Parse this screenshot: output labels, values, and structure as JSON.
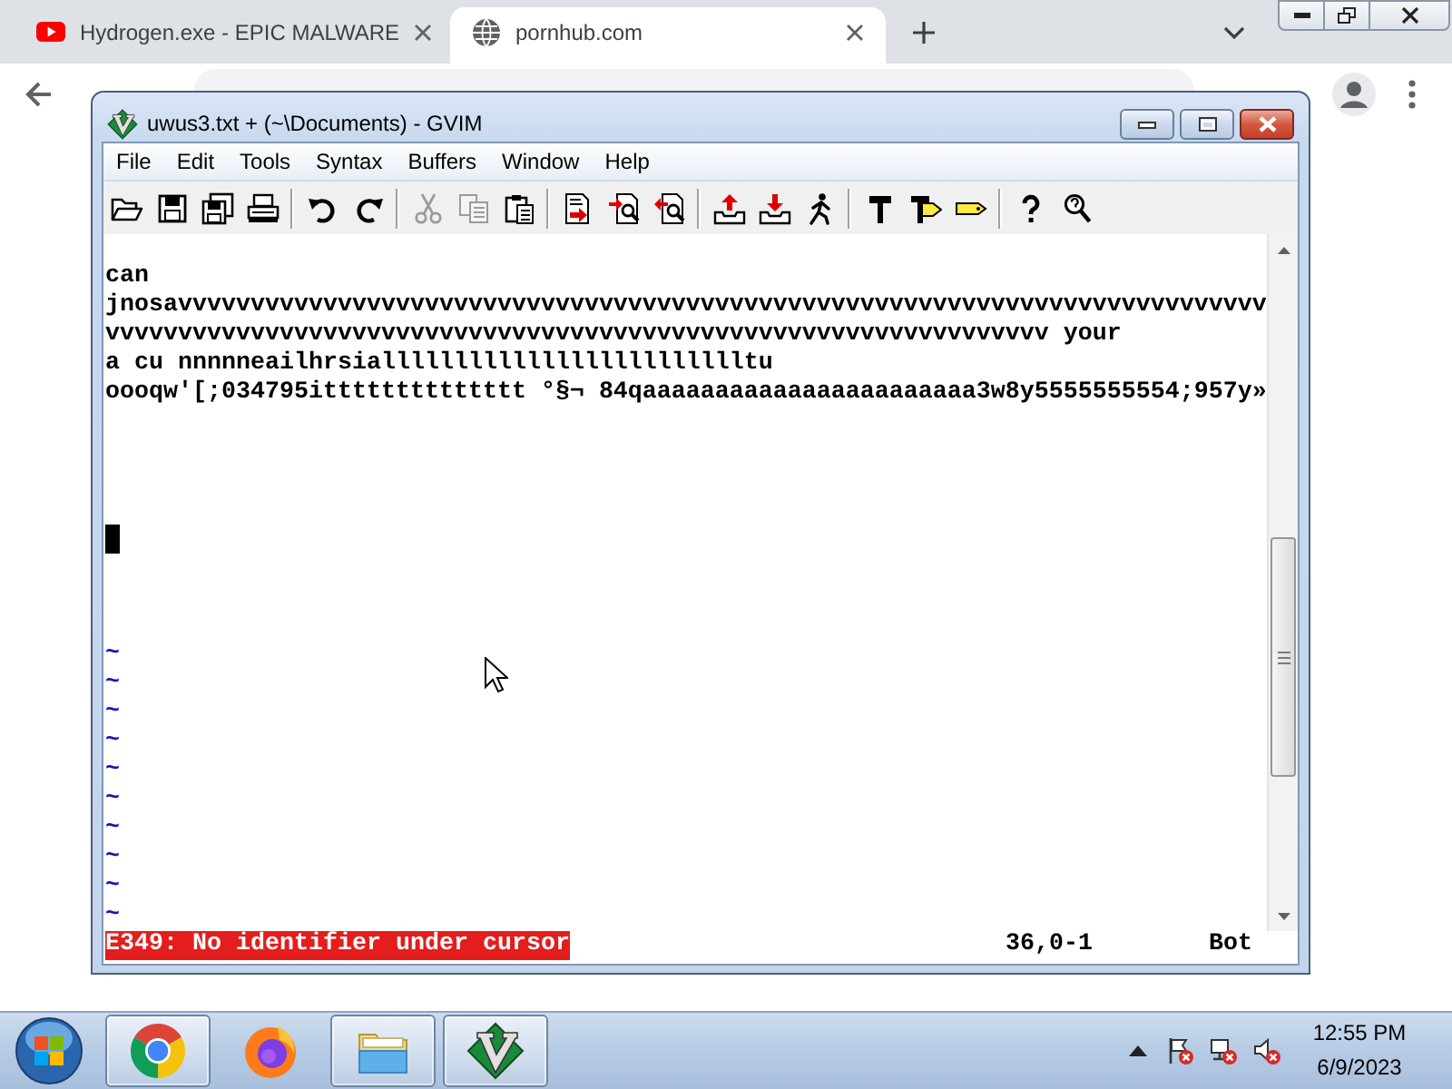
{
  "browser": {
    "tabs": [
      {
        "kind": "video",
        "title": "Hydrogen.exe - EPIC MALWARE",
        "selected": false
      },
      {
        "kind": "globe",
        "title": "pornhub.com",
        "selected": true
      }
    ]
  },
  "gvim": {
    "title": "uwus3.txt + (~\\Documents) - GVIM",
    "menu": [
      "File",
      "Edit",
      "Tools",
      "Syntax",
      "Buffers",
      "Window",
      "Help"
    ],
    "toolbar": [
      [
        {
          "kind": "open",
          "disabled": false
        },
        {
          "kind": "save",
          "disabled": false
        },
        {
          "kind": "saveall",
          "disabled": false
        },
        {
          "kind": "print",
          "disabled": false
        }
      ],
      [
        {
          "kind": "undo",
          "disabled": false
        },
        {
          "kind": "redo",
          "disabled": false
        }
      ],
      [
        {
          "kind": "cut",
          "disabled": true
        },
        {
          "kind": "copy",
          "disabled": true
        },
        {
          "kind": "paste",
          "disabled": false
        }
      ],
      [
        {
          "kind": "replace",
          "disabled": false
        },
        {
          "kind": "findnext",
          "disabled": false
        },
        {
          "kind": "findprev",
          "disabled": false
        }
      ],
      [
        {
          "kind": "loadsession",
          "disabled": false
        },
        {
          "kind": "savesession",
          "disabled": false
        },
        {
          "kind": "runscript",
          "disabled": false
        }
      ],
      [
        {
          "kind": "make",
          "disabled": false
        },
        {
          "kind": "maketags",
          "disabled": false
        },
        {
          "kind": "jumptag",
          "disabled": false
        }
      ],
      [
        {
          "kind": "help",
          "disabled": false
        },
        {
          "kind": "findhelp",
          "disabled": false
        }
      ]
    ],
    "lines": [
      {
        "cursor": false
      },
      {
        "text": "can",
        "cursor": false
      },
      {
        "text": "jnosavvvvvvvvvvvvvvvvvvvvvvvvvvvvvvvvvvvvvvvvvvvvvvvvvvvvvvvvvvvvvvvvvvvvvvvvvvv",
        "cursor": false
      },
      {
        "text": "vvvvvvvvvvvvvvvvvvvvvvvvvvvvvvvvvvvvvvvvvvvvvvvvvvvvvvvvvvvvvvvvv your",
        "cursor": false
      },
      {
        "text": "a cu nnnnneailhrsiallllllllllllllllllllllllltu",
        "cursor": false
      },
      {
        "text": "oooqw'[;034795itttttttttttttt °§¬ 84qaaaaaaaaaaaaaaaaaaaaaaa3w8y5555555554;957y»",
        "cursor": false
      },
      {
        "cursor": false
      },
      {
        "cursor": false
      },
      {
        "cursor": false
      },
      {
        "cursor": false
      },
      {
        "cursor": true
      },
      {
        "cursor": false
      },
      {
        "cursor": false
      },
      {
        "cursor": false
      }
    ],
    "filler_lines": [
      "~",
      "~",
      "~",
      "~",
      "~",
      "~",
      "~",
      "~",
      "~",
      "~"
    ],
    "message": {
      "kind": "error",
      "text": "E349: No identifier under cursor"
    },
    "cursor_position": "36,0-1",
    "scroll_position": "Bot"
  },
  "taskbar": {
    "apps": [
      {
        "kind": "chrome",
        "running": true
      },
      {
        "kind": "firefox",
        "running": false
      },
      {
        "kind": "explorer",
        "running": true
      },
      {
        "kind": "vim",
        "running": true
      }
    ],
    "tray": [
      {
        "kind": "flag",
        "alert": true
      },
      {
        "kind": "network",
        "alert": true
      },
      {
        "kind": "speaker",
        "alert": true
      }
    ],
    "time": "12:55 PM",
    "date": "6/9/2023"
  }
}
